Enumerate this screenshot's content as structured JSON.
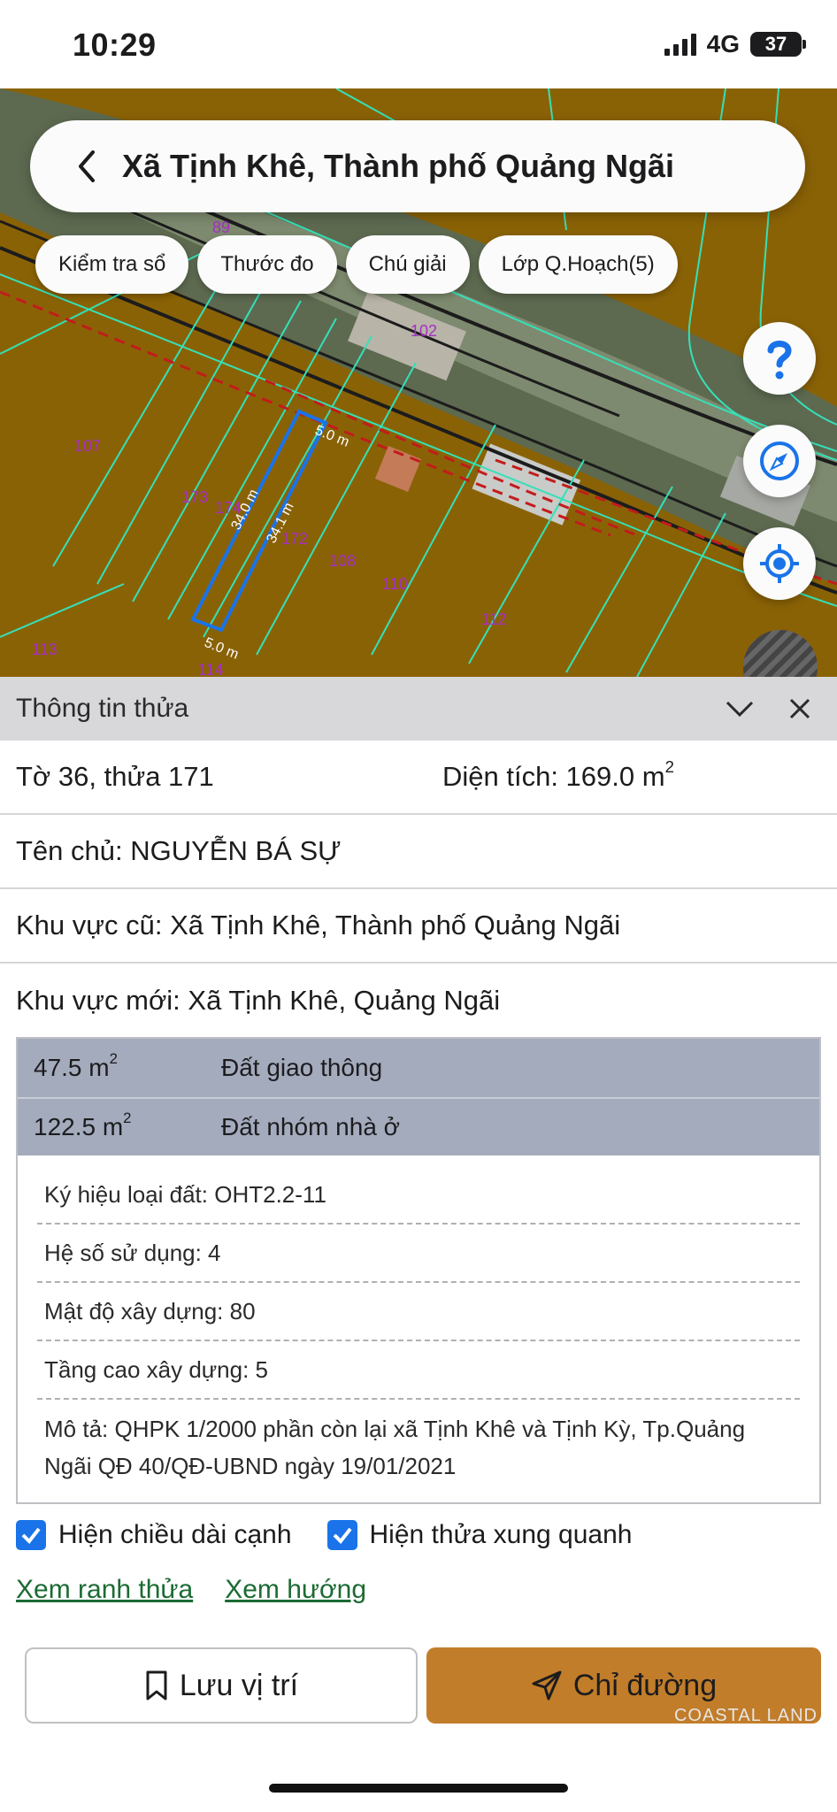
{
  "status": {
    "time": "10:29",
    "network": "4G",
    "battery": "37"
  },
  "map": {
    "title": "Xã Tịnh Khê, Thành phố Quảng Ngãi",
    "chips": [
      "Kiểm tra sổ",
      "Thước đo",
      "Chú giải",
      "Lớp Q.Hoạch(5)"
    ],
    "parcel_labels": [
      "89",
      "102",
      "107",
      "173",
      "174",
      "172",
      "108",
      "110",
      "112",
      "113",
      "114"
    ],
    "dimensions": {
      "top": "5.0 m",
      "bottom": "5.0 m",
      "left": "34.0 m",
      "right": "34.1 m"
    },
    "colors": {
      "land": "#8a6206",
      "boundary": "#35e0b8",
      "selected": "#1a73e8"
    }
  },
  "panel": {
    "title": "Thông tin thửa",
    "sheet_parcel": "Tờ 36, thửa 171",
    "area_label": "Diện tích: 169.0 m",
    "area_sup": "2",
    "owner": "Tên chủ: NGUYỄN BÁ SỰ",
    "old_area": "Khu vực cũ: Xã Tịnh Khê, Thành phố Quảng Ngãi",
    "new_area": "Khu vực mới: Xã Tịnh Khê, Quảng Ngãi",
    "land_uses": [
      {
        "area": "47.5 m",
        "sup": "2",
        "type": "Đất giao thông"
      },
      {
        "area": "122.5 m",
        "sup": "2",
        "type": "Đất nhóm nhà ở"
      }
    ],
    "attributes": {
      "symbol": "Ký hiệu loại đất: OHT2.2-11",
      "usage": "Hệ số sử dụng: 4",
      "density": "Mật độ xây dựng: 80",
      "floors": "Tầng cao xây dựng: 5",
      "description": "Mô tả: QHPK 1/2000 phần còn lại xã Tịnh Khê và Tịnh Kỳ, Tp.Quảng Ngãi QĐ 40/QĐ-UBND ngày 19/01/2021"
    },
    "checks": {
      "edge_length": "Hiện chiều dài cạnh",
      "neighbors": "Hiện thửa xung quanh"
    },
    "links": {
      "boundary": "Xem ranh thửa",
      "direction": "Xem hướng"
    },
    "buttons": {
      "save": "Lưu vị trí",
      "directions": "Chỉ đường"
    },
    "watermark": "COASTAL LAND"
  }
}
